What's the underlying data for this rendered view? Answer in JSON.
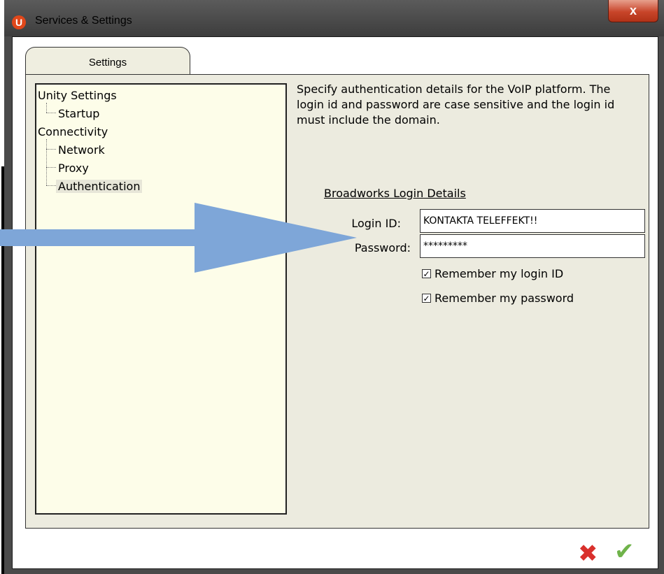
{
  "window": {
    "title": "Services & Settings",
    "close_label": "x",
    "logo_letter": "U"
  },
  "tabs": [
    {
      "label": "Settings"
    }
  ],
  "tree": {
    "groups": [
      {
        "label": "Unity Settings",
        "children": [
          "Startup"
        ]
      },
      {
        "label": "Connectivity",
        "children": [
          "Network",
          "Proxy",
          "Authentication"
        ]
      }
    ],
    "selected": "Authentication"
  },
  "description": "Specify authentication details for the VoIP platform. The login id and password are case sensitive and the login id must include the domain.",
  "login_section": {
    "title": "Broadworks Login Details",
    "login_id_label": "Login ID:",
    "login_id_value": "KONTAKTA TELEFFEKT!!",
    "password_label": "Password:",
    "password_value": "*********",
    "remember_login_label": "Remember my login ID",
    "remember_login_checked": true,
    "remember_password_label": "Remember my password",
    "remember_password_checked": true
  },
  "footer": {
    "cancel_icon": "cancel-x-icon",
    "ok_icon": "ok-check-icon"
  },
  "colors": {
    "arrow": "#7ea6d8",
    "panel_bg": "#ecebdf",
    "tree_bg": "#fdfde9",
    "close_red": "#c8452a"
  }
}
